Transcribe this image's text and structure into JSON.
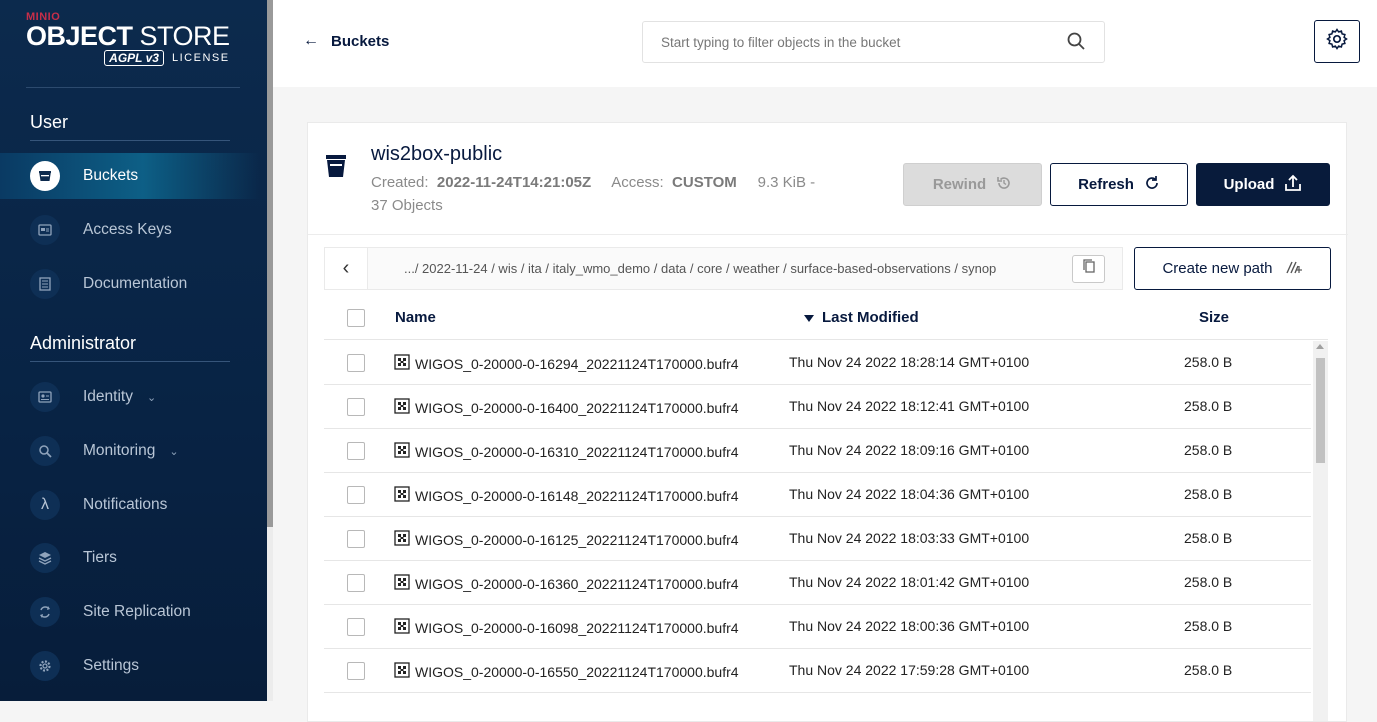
{
  "sidebar": {
    "brand": "MINIO",
    "title_bold": "OBJECT",
    "title_light": " STORE",
    "agpl": "AGPL v3",
    "license": "LICENSE",
    "user_section": "User",
    "admin_section": "Administrator",
    "user_items": [
      {
        "label": "Buckets",
        "icon": "bucket-icon",
        "active": true
      },
      {
        "label": "Access Keys",
        "icon": "key-icon"
      },
      {
        "label": "Documentation",
        "icon": "document-icon"
      }
    ],
    "admin_items": [
      {
        "label": "Identity",
        "icon": "identity-icon",
        "expandable": true
      },
      {
        "label": "Monitoring",
        "icon": "monitoring-icon",
        "expandable": true
      },
      {
        "label": "Notifications",
        "icon": "lambda-icon"
      },
      {
        "label": "Tiers",
        "icon": "layers-icon"
      },
      {
        "label": "Site Replication",
        "icon": "replication-icon"
      },
      {
        "label": "Settings",
        "icon": "settings-icon"
      }
    ]
  },
  "header": {
    "back_label": "Buckets",
    "search_placeholder": "Start typing to filter objects in the bucket"
  },
  "bucket": {
    "name": "wis2box-public",
    "created_label": "Created:",
    "created_value": "2022-11-24T14:21:05Z",
    "access_label": "Access:",
    "access_value": "CUSTOM",
    "size": "9.3 KiB -",
    "objects": "37 Objects"
  },
  "actions": {
    "rewind": "Rewind",
    "refresh": "Refresh",
    "upload": "Upload",
    "create_path": "Create new path"
  },
  "breadcrumb": {
    "path": ".../ 2022-11-24 / wis / ita / italy_wmo_demo / data / core / weather / surface-based-observations / synop"
  },
  "table": {
    "columns": {
      "name": "Name",
      "modified": "Last Modified",
      "size": "Size"
    },
    "sort": "descending",
    "rows": [
      {
        "name": "WIGOS_0-20000-0-16294_20221124T170000.bufr4",
        "modified": "Thu Nov 24 2022 18:28:14 GMT+0100",
        "size": "258.0 B"
      },
      {
        "name": "WIGOS_0-20000-0-16400_20221124T170000.bufr4",
        "modified": "Thu Nov 24 2022 18:12:41 GMT+0100",
        "size": "258.0 B"
      },
      {
        "name": "WIGOS_0-20000-0-16310_20221124T170000.bufr4",
        "modified": "Thu Nov 24 2022 18:09:16 GMT+0100",
        "size": "258.0 B"
      },
      {
        "name": "WIGOS_0-20000-0-16148_20221124T170000.bufr4",
        "modified": "Thu Nov 24 2022 18:04:36 GMT+0100",
        "size": "258.0 B"
      },
      {
        "name": "WIGOS_0-20000-0-16125_20221124T170000.bufr4",
        "modified": "Thu Nov 24 2022 18:03:33 GMT+0100",
        "size": "258.0 B"
      },
      {
        "name": "WIGOS_0-20000-0-16360_20221124T170000.bufr4",
        "modified": "Thu Nov 24 2022 18:01:42 GMT+0100",
        "size": "258.0 B"
      },
      {
        "name": "WIGOS_0-20000-0-16098_20221124T170000.bufr4",
        "modified": "Thu Nov 24 2022 18:00:36 GMT+0100",
        "size": "258.0 B"
      },
      {
        "name": "WIGOS_0-20000-0-16550_20221124T170000.bufr4",
        "modified": "Thu Nov 24 2022 17:59:28 GMT+0100",
        "size": "258.0 B"
      }
    ]
  },
  "colors": {
    "sidebar_bg": "#0c2a4d",
    "primary": "#081b3b",
    "active_item": "#0d5f86"
  }
}
